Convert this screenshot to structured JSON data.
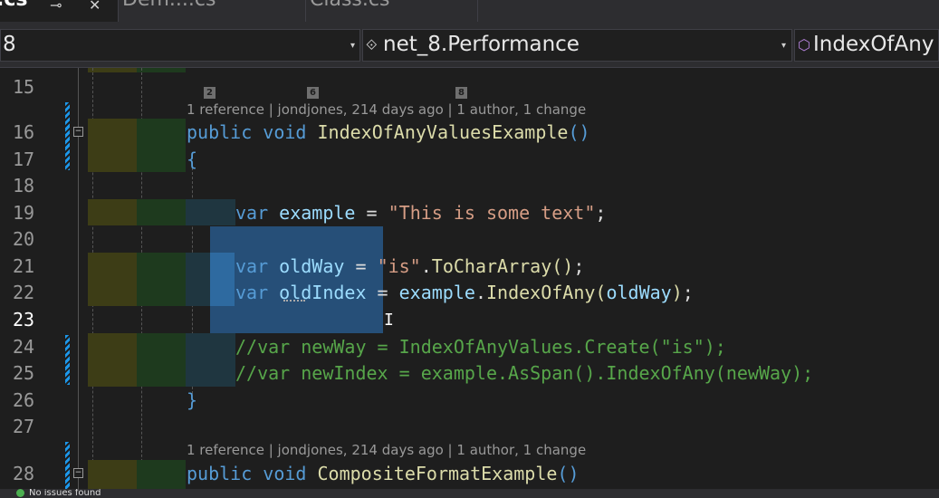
{
  "tabs": [
    {
      "label": ".cs",
      "active": true
    },
    {
      "label": "Dem....cs",
      "active": false
    },
    {
      "label": "Class.cs",
      "active": false
    }
  ],
  "nav": {
    "project": "8",
    "namespace": "net_8.Performance",
    "member": "IndexOfAny"
  },
  "codelens": [
    {
      "line": 16,
      "numbers": [
        "2",
        "6",
        "8"
      ],
      "text": "1 reference | jondjones, 214 days ago | 1 author, 1 change"
    },
    {
      "line": 28,
      "text": "1 reference | jondjones, 214 days ago | 1 author, 1 change"
    }
  ],
  "line_numbers": [
    "15",
    "16",
    "17",
    "18",
    "19",
    "20",
    "21",
    "22",
    "23",
    "24",
    "25",
    "26",
    "27",
    "28"
  ],
  "current_line": "23",
  "code": {
    "l16": {
      "kw1": "public",
      "kw2": "void",
      "name": "IndexOfAnyValuesExample",
      "parens": "()"
    },
    "l17": "{",
    "l19": {
      "kw": "var",
      "id": "example",
      "eq": "=",
      "str": "\"This is some text\"",
      "semi": ";"
    },
    "l21": {
      "kw": "var",
      "id": "oldWay",
      "eq": "=",
      "str": "\"is\"",
      "dot": ".",
      "method": "ToCharArray",
      "parens": "()",
      "semi": ";"
    },
    "l22": {
      "kw": "var",
      "id": "oldIndex",
      "eq": "=",
      "obj": "example",
      "dot": ".",
      "method": "IndexOfAny",
      "open": "(",
      "arg": "oldWay",
      "close": ")",
      "semi": ";"
    },
    "l24": "//var newWay = IndexOfAnyValues.Create(\"is\");",
    "l25": "//var newIndex = example.AsSpan().IndexOfAny(newWay);",
    "l26": "}",
    "l28": {
      "kw1": "public",
      "kw2": "void",
      "name": "CompositeFormatExample",
      "parens": "()"
    }
  },
  "status": {
    "text": "No issues found"
  },
  "colors": {
    "keyword": "#569cd6",
    "method": "#dcdcaa",
    "string": "#d69d85",
    "comment": "#57a64a",
    "selection": "#264f78"
  }
}
